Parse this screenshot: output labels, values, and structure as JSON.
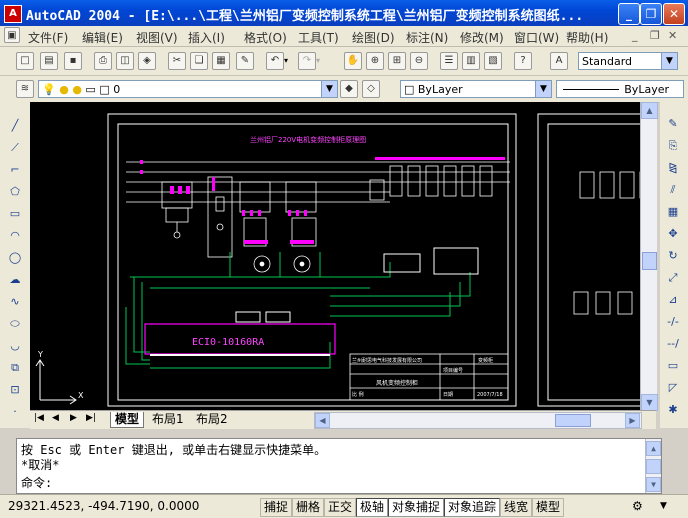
{
  "window": {
    "title": "AutoCAD 2004 - [E:\\...\\工程\\兰州铝厂变频控制系统工程\\兰州铝厂变频控制系统图纸...",
    "minimize": "_",
    "restore": "❐",
    "close": "✕"
  },
  "menu": {
    "items": [
      "文件(F)",
      "编辑(E)",
      "视图(V)",
      "插入(I)",
      "格式(O)",
      "工具(T)",
      "绘图(D)",
      "标注(N)",
      "修改(M)",
      "窗口(W)",
      "帮助(H)"
    ]
  },
  "toolbar": {
    "text_style": "Standard",
    "layer": "0",
    "color": "ByLayer",
    "linetype": "ByLayer"
  },
  "drawing": {
    "title": "兰州铝厂220V电机变频控制柜原理图",
    "controller_label": "ECI0-10160RA",
    "company": "兰州耐思电气科技发展有限公司",
    "block_name": "风机变频控制柜",
    "date": "2007/7/18",
    "label_date": "日期",
    "label_scale": "比 例",
    "label_project": "项目编号",
    "label_drawing": "变频柜"
  },
  "tabs": {
    "model": "模型",
    "layout1": "布局1",
    "layout2": "布局2"
  },
  "command": {
    "line1": "按 Esc 或 Enter 键退出, 或单击右键显示快捷菜单。",
    "line2": "*取消*",
    "prompt": "命令:"
  },
  "status": {
    "coords": "29321.4523, -494.7190, 0.0000",
    "toggles": [
      "捕捉",
      "栅格",
      "正交",
      "极轴",
      "对象捕捉",
      "对象追踪",
      "线宽",
      "模型"
    ]
  },
  "colors": {
    "title_bar": "#0046d5",
    "canvas_bg": "#000000",
    "wire_green": "#00c853",
    "component_magenta": "#ff00ff",
    "text_magenta": "#ff44ff"
  }
}
